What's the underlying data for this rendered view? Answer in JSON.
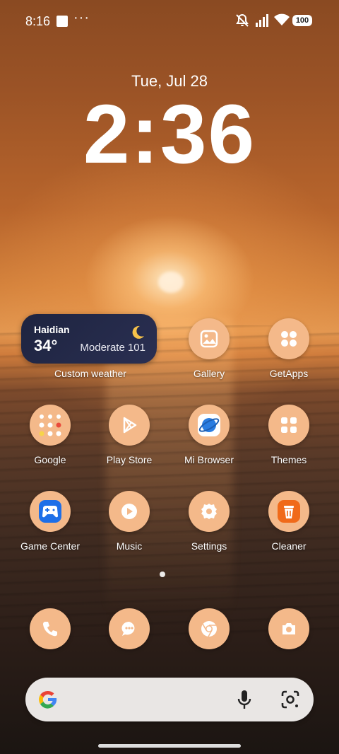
{
  "status": {
    "time": "8:16",
    "overflow": "···",
    "battery": "100"
  },
  "lockscreen": {
    "date": "Tue, Jul 28",
    "clock": "2:36"
  },
  "weather_widget": {
    "city": "Haidian",
    "temperature": "34°",
    "air_quality": "Moderate 101",
    "label": "Custom weather"
  },
  "apps": {
    "gallery": "Gallery",
    "getapps": "GetApps",
    "google": "Google",
    "playstore": "Play Store",
    "mibrowser": "Mi Browser",
    "themes": "Themes",
    "gamecenter": "Game Center",
    "music": "Music",
    "settings": "Settings",
    "cleaner": "Cleaner"
  },
  "dock": [
    "phone",
    "messages",
    "chrome",
    "camera"
  ],
  "colors": {
    "app_icon_bg": "#f4b98a",
    "icon_white": "#ffffff",
    "cleaner_orange": "#f06a1a",
    "widget_bg": "#1e2440"
  }
}
